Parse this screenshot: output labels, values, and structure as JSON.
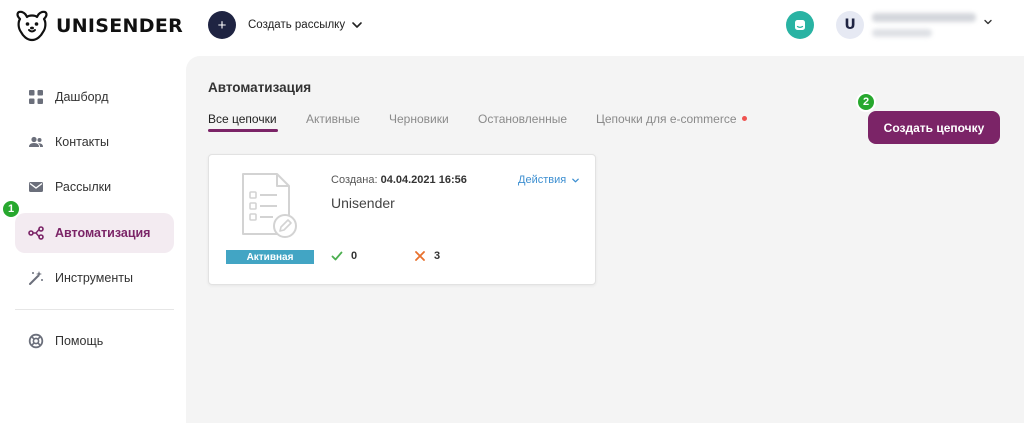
{
  "header": {
    "logo_text": "UNISENDER",
    "create_campaign_label": "Создать рассылку",
    "avatar_initial": "U"
  },
  "sidebar": {
    "items": [
      {
        "label": "Дашборд",
        "icon": "dashboard-icon"
      },
      {
        "label": "Контакты",
        "icon": "contacts-icon"
      },
      {
        "label": "Рассылки",
        "icon": "mail-icon"
      },
      {
        "label": "Автоматизация",
        "icon": "automation-icon",
        "active": true
      },
      {
        "label": "Инструменты",
        "icon": "magic-wand-icon"
      },
      {
        "label": "Помощь",
        "icon": "help-icon"
      }
    ]
  },
  "markers": {
    "step1": "1",
    "step2": "2"
  },
  "main": {
    "title": "Автоматизация",
    "tabs": [
      {
        "label": "Все цепочки",
        "active": true
      },
      {
        "label": "Активные"
      },
      {
        "label": "Черновики"
      },
      {
        "label": "Остановленные"
      },
      {
        "label": "Цепочки для e-commerce",
        "has_dot": true
      }
    ],
    "create_chain_label": "Создать цепочку"
  },
  "card": {
    "created_label": "Создана:",
    "created_date": "04.04.2021 16:56",
    "actions_label": "Действия",
    "name": "Unisender",
    "status": "Активная",
    "success_count": "0",
    "fail_count": "3"
  },
  "colors": {
    "accent": "#7b2467",
    "status_active": "#42a5c4",
    "success": "#4caf50",
    "fail": "#e8712e",
    "chat": "#29b3a3",
    "marker": "#27a82e"
  }
}
